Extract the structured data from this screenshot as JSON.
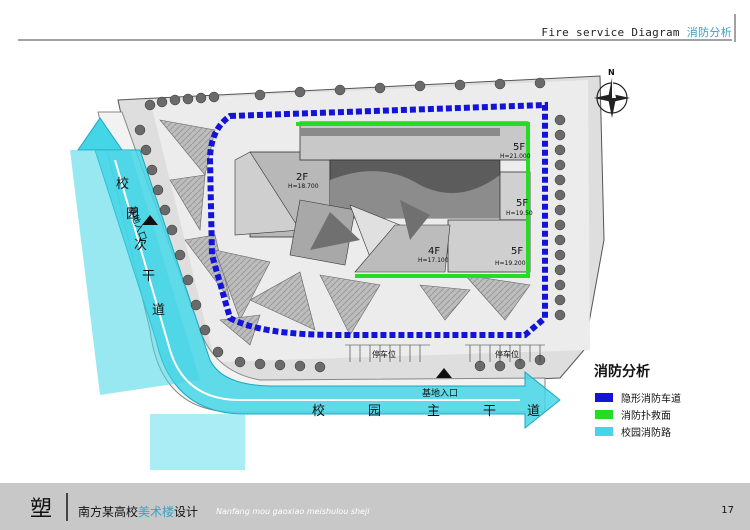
{
  "header": {
    "title_en": "Fire service Diagram",
    "title_cn": "消防分析"
  },
  "compass": {
    "north": "N"
  },
  "map": {
    "labels": {
      "floor_5f_a": "5F",
      "height_5f_a": "H=21.000",
      "floor_5f_b": "5F",
      "height_5f_b": "H=19.50",
      "floor_5f_c": "5F",
      "height_5f_c": "H=19.200",
      "floor_2f": "2F",
      "height_2f": "H=18.700",
      "floor_4f": "4F",
      "height_4f": "H=17.100",
      "parking_left": "停车位",
      "parking_right": "停车位",
      "site_entrance_main": "基地入口",
      "site_entrance_side": "基地入口",
      "road_secondary": [
        "校",
        "园",
        "次",
        "干",
        "道"
      ],
      "road_main": [
        "校",
        "园",
        "主",
        "干",
        "道"
      ]
    }
  },
  "legend": {
    "title": "消防分析",
    "items": [
      {
        "label": "隐形消防车道",
        "color": "#1414d8"
      },
      {
        "label": "消防扑救面",
        "color": "#22dd22"
      },
      {
        "label": "校园消防路",
        "color": "#44d6e6"
      }
    ]
  },
  "footer": {
    "logo": "塑",
    "school_prefix": "南方某高校",
    "school_accent": "美术楼",
    "school_suffix": "设计",
    "pinyin": "Nanfang mou gaoxiao meishulou sheji",
    "page": "17"
  }
}
